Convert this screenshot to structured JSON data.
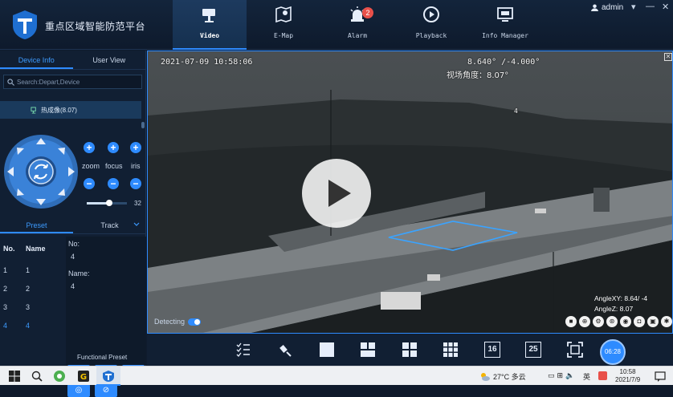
{
  "header": {
    "title": "重点区域智能防范平台",
    "nav": [
      {
        "label": "Video",
        "icon": "camera-icon",
        "active": true
      },
      {
        "label": "E-Map",
        "icon": "map-icon"
      },
      {
        "label": "Alarm",
        "icon": "alarm-icon",
        "badge": "2"
      },
      {
        "label": "Playback",
        "icon": "playback-icon"
      },
      {
        "label": "Info Manager",
        "icon": "monitor-icon"
      }
    ],
    "user": "admin",
    "window_controls": {
      "dropdown": "▾",
      "minimize": "—",
      "close": "✕"
    }
  },
  "sidebar": {
    "tabs": [
      "Device Info",
      "User View"
    ],
    "search_placeholder": "Search:Depart,Device",
    "device": "热成像(8.07)",
    "ptz_labels": [
      "zoom",
      "focus",
      "iris"
    ],
    "speed": 32,
    "speed_fraction": 0.56,
    "tabs2": [
      "Preset",
      "Track"
    ],
    "table": {
      "headers": [
        "No.",
        "Name"
      ],
      "rows": [
        [
          "1",
          "1"
        ],
        [
          "2",
          "2"
        ],
        [
          "3",
          "3"
        ],
        [
          "4",
          "4"
        ]
      ]
    },
    "detail": {
      "no_label": "No:",
      "no_value": "4",
      "name_label": "Name:",
      "name_value": "4"
    },
    "functional_preset": "Functional Preset"
  },
  "video": {
    "datetime": "2021-07-09 10:58:06",
    "angles_top": "8.640° /-4.000°",
    "view_angle": "视场角度：8.07°",
    "angle_xy": "AngleXY: 8.64/ -4",
    "angle_z": "AngleZ: 8.07",
    "detecting": "Detecting",
    "region_number": "4"
  },
  "toolbar": {
    "time": "06:28",
    "layouts": [
      "16",
      "25"
    ]
  },
  "taskbar": {
    "weather": "27°C 多云",
    "time": "10:58",
    "date": "2021/7/9",
    "ime": "英"
  },
  "colors": {
    "accent": "#2e8bff",
    "badge": "#e8504a"
  }
}
